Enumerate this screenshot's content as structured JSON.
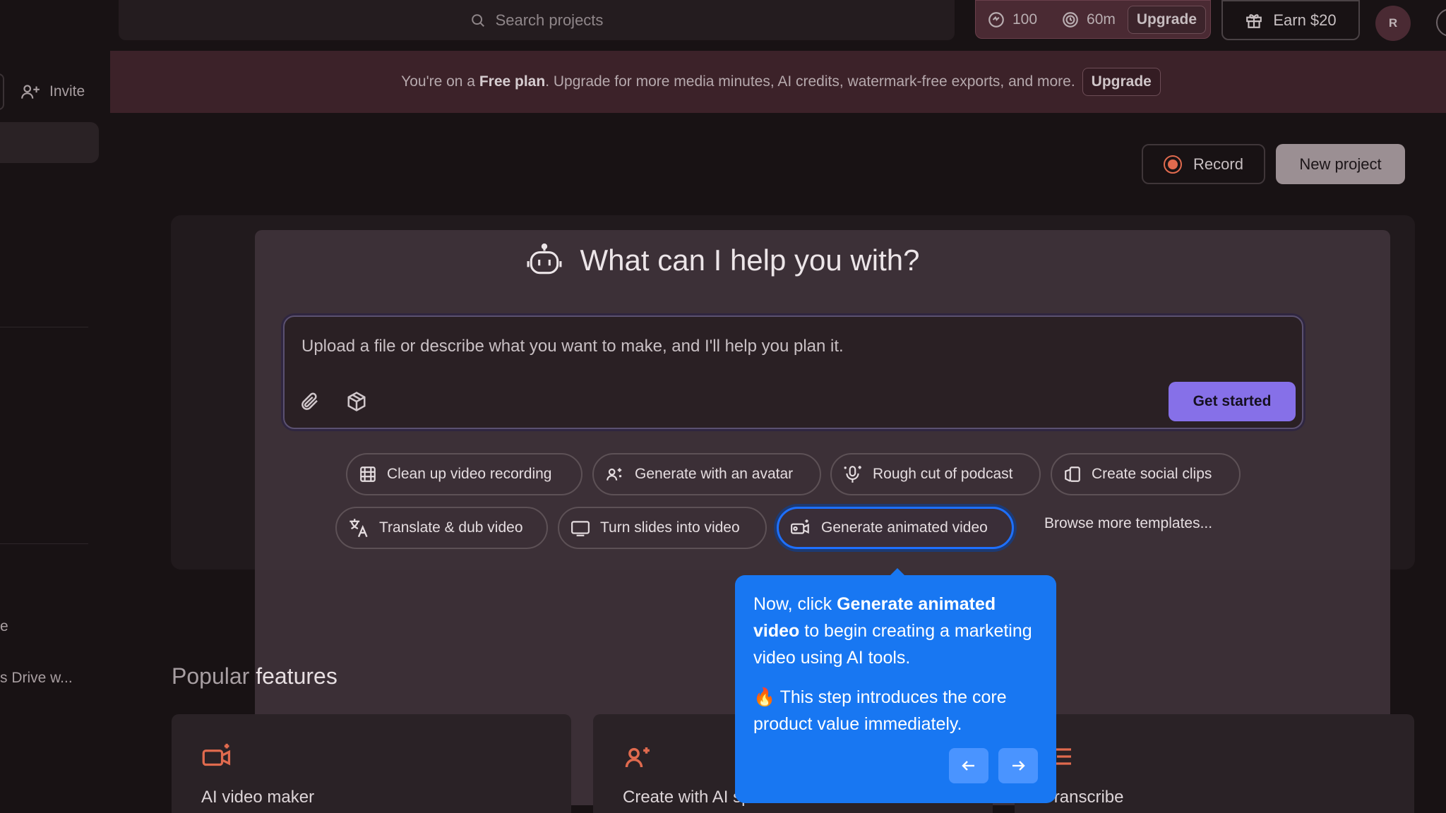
{
  "topbar": {
    "search_placeholder": "Search projects",
    "credits_ai": "100",
    "credits_minutes": "60m",
    "upgrade_label": "Upgrade",
    "earn_label": "Earn $20",
    "avatar_initial": "R"
  },
  "sidebar": {
    "invite_label": "Invite",
    "item_partial_1": "e",
    "item_partial_2": "s Drive w..."
  },
  "banner": {
    "prefix": "You're on a ",
    "plan": "Free plan",
    "suffix": ". Upgrade for more media minutes, AI credits, watermark-free exports, and more.",
    "upgrade_label": "Upgrade"
  },
  "actions": {
    "record_label": "Record",
    "new_project_label": "New project"
  },
  "assistant": {
    "heading": "What can I help you with?",
    "prompt_placeholder": "Upload a file or describe what you want to make, and I'll help you plan it.",
    "get_started_label": "Get started",
    "chips": [
      {
        "label": "Clean up video recording",
        "icon": "film-icon"
      },
      {
        "label": "Generate with an avatar",
        "icon": "avatar-sparkle-icon"
      },
      {
        "label": "Rough cut of podcast",
        "icon": "microphone-sparkle-icon"
      },
      {
        "label": "Create social clips",
        "icon": "social-clip-icon"
      },
      {
        "label": "Translate & dub video",
        "icon": "translate-icon"
      },
      {
        "label": "Turn slides into video",
        "icon": "slides-icon"
      },
      {
        "label": "Generate animated video",
        "icon": "animated-video-icon"
      }
    ],
    "browse_label": "Browse more templates..."
  },
  "popular": {
    "title_dim": "Popular",
    "title_bright": "features",
    "features": [
      {
        "label": "AI video maker",
        "icon": "ai-video-icon"
      },
      {
        "label": "Create with AI speaker",
        "icon": "ai-speaker-icon"
      },
      {
        "label": "Transcribe",
        "icon": "transcribe-icon"
      }
    ]
  },
  "tooltip": {
    "line_prefix": "Now, click ",
    "line_bold": "Generate animated video",
    "line_suffix": " to begin creating a marketing video using AI tools.",
    "emoji": "🔥",
    "note": " This step introduces the core product value immediately."
  },
  "colors": {
    "accent": "#8670e8",
    "tooltip": "#1877f2",
    "record": "#e06a4e",
    "feature_icon": "#e06a4e"
  }
}
